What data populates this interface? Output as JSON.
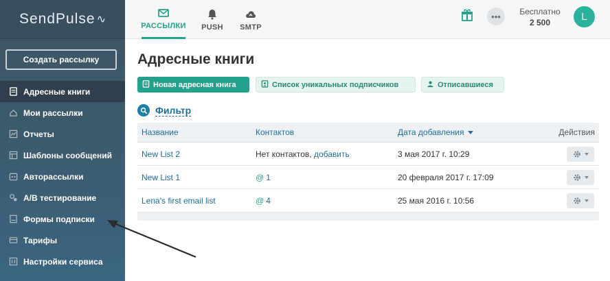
{
  "app": {
    "logo": "SendPulse",
    "logo_mark": "∿"
  },
  "sidebar": {
    "create_button": "Создать рассылку",
    "items": [
      {
        "label": "Адресные книги",
        "icon": "address-book-icon",
        "active": true
      },
      {
        "label": "Мои рассылки",
        "icon": "campaigns-icon",
        "active": false
      },
      {
        "label": "Отчеты",
        "icon": "reports-icon",
        "active": false
      },
      {
        "label": "Шаблоны сообщений",
        "icon": "templates-icon",
        "active": false
      },
      {
        "label": "Авторассылки",
        "icon": "automation-icon",
        "active": false
      },
      {
        "label": "A/B тестирование",
        "icon": "ab-test-icon",
        "active": false
      },
      {
        "label": "Формы подписки",
        "icon": "forms-icon",
        "active": false
      },
      {
        "label": "Тарифы",
        "icon": "pricing-icon",
        "active": false
      },
      {
        "label": "Настройки сервиса",
        "icon": "settings-icon",
        "active": false
      }
    ]
  },
  "topbar": {
    "tabs": [
      {
        "label": "РАССЫЛКИ",
        "icon": "envelope-icon",
        "active": true
      },
      {
        "label": "PUSH",
        "icon": "bell-icon",
        "active": false
      },
      {
        "label": "SMTP",
        "icon": "cloud-icon",
        "active": false
      }
    ],
    "gift_icon": "gift-icon",
    "more_icon": "more-dots-icon",
    "more_label": "•••",
    "plan_name": "Бесплатно",
    "plan_count": "2 500",
    "avatar_letter": "L"
  },
  "main": {
    "title": "Адресные книги",
    "buttons": {
      "new_book": "Новая адресная книга",
      "unique_list": "Список уникальных подписчиков",
      "unsubscribed": "Отписавшиеся"
    },
    "filter_label": "Фильтр",
    "table": {
      "headers": {
        "name": "Название",
        "contacts": "Контактов",
        "date": "Дата добавления",
        "actions": "Действия"
      },
      "rows": [
        {
          "name": "New List 2",
          "contacts_text": "Нет контактов,",
          "contacts_link": "добавить",
          "date": "3 мая 2017 г. 10:29"
        },
        {
          "name": "New List 1",
          "contacts_at": "@",
          "contacts_count": "1",
          "date": "20 февраля 2017 г. 17:09"
        },
        {
          "name": "Lena's first email list",
          "contacts_at": "@",
          "contacts_count": "4",
          "date": "25 мая 2016 г. 10:56"
        }
      ]
    }
  },
  "colors": {
    "accent": "#23a18a",
    "link": "#1f6e9a",
    "sidebar": "#3e5566"
  }
}
